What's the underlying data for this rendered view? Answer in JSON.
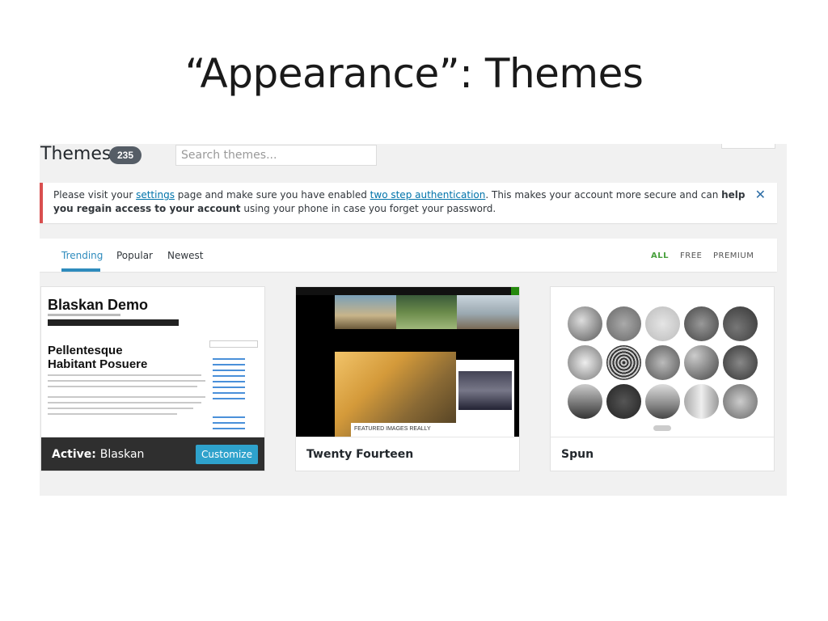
{
  "slide_title": "“Appearance”: Themes",
  "header": {
    "title": "Themes",
    "count": "235",
    "search_placeholder": "Search themes..."
  },
  "notice": {
    "text_1": "Please visit your ",
    "link_settings": "settings",
    "text_2": " page and make sure you have enabled ",
    "link_two_step": "two step authentication",
    "text_3": ". This makes your account more secure and can ",
    "bold_1": "help you regain access to your account",
    "text_4": " using your phone in case you forget your password.",
    "close_icon": "close-icon"
  },
  "filters": {
    "tabs": [
      "Trending",
      "Popular",
      "Newest"
    ],
    "active_tab": "Trending",
    "options": [
      "ALL",
      "FREE",
      "PREMIUM"
    ],
    "active_option": "ALL"
  },
  "themes": [
    {
      "status_label": "Active:",
      "name": "Blaskan",
      "action": "Customize",
      "preview": {
        "site_title": "Blaskan Demo",
        "headline_1": "Pellentesque",
        "headline_2": "Habitant Posuere"
      }
    },
    {
      "name": "Twenty Fourteen",
      "preview": {
        "caption": "FEATURED IMAGES REALLY"
      }
    },
    {
      "name": "Spun"
    }
  ],
  "colors": {
    "accent_blue": "#2e8bbd",
    "notice_red": "#d94f4f",
    "active_green": "#48a03c",
    "customize_button": "#2ea2cc"
  }
}
